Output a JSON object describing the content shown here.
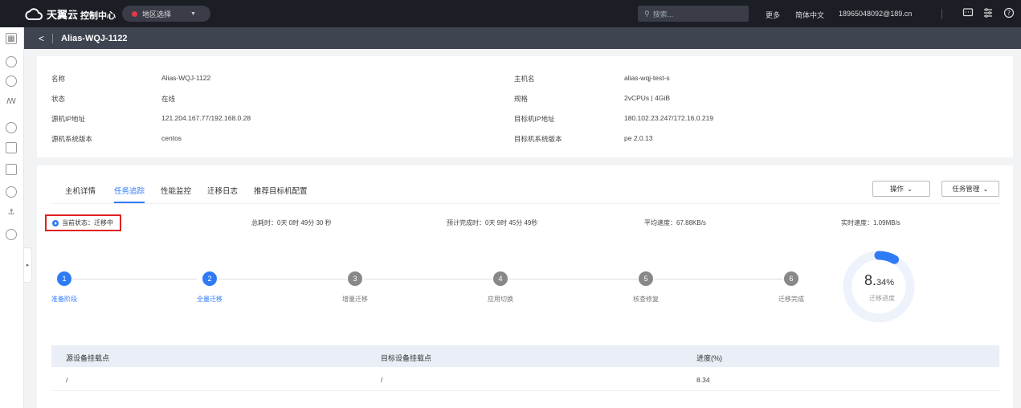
{
  "topbar": {
    "brand": "天翼云",
    "console": "控制中心",
    "region": "地区选择",
    "search_placeholder": "搜索...",
    "more": "更多",
    "language": "简体中文",
    "user": "18965048092@189.cn"
  },
  "subheader": {
    "back": "<",
    "title": "Alias-WQJ-1122"
  },
  "info": {
    "left": [
      {
        "label": "名称",
        "value": "Alias-WQJ-1122"
      },
      {
        "label": "状态",
        "value": "在线"
      },
      {
        "label": "源机IP地址",
        "value": "121.204.167.77/192.168.0.28"
      },
      {
        "label": "源机系统版本",
        "value": "centos"
      }
    ],
    "right": [
      {
        "label": "主机名",
        "value": "alias-wqj-test-s"
      },
      {
        "label": "规格",
        "value": "2vCPUs | 4GiB"
      },
      {
        "label": "目标机IP地址",
        "value": "180.102.23.247/172.16.0.219"
      },
      {
        "label": "目标机系统版本",
        "value": "pe 2.0.13"
      }
    ]
  },
  "tabs": [
    "主机详情",
    "任务追踪",
    "性能监控",
    "迁移日志",
    "推荐目标机配置"
  ],
  "active_tab": "任务追踪",
  "buttons": {
    "operate": "操作",
    "task_manage": "任务管理"
  },
  "status": {
    "current": "当前状态：迁移中",
    "elapsed": "总耗时：0天 0时 49分 30 秒",
    "eta": "预计完成时：0天 9时 45分 49秒",
    "avg_speed": "平均速度：67.88KB/s",
    "realtime_speed": "实时速度：1.09MB/s"
  },
  "steps": [
    {
      "num": "1",
      "label": "准备阶段",
      "done": true
    },
    {
      "num": "2",
      "label": "全量迁移",
      "done": true
    },
    {
      "num": "3",
      "label": "增量迁移",
      "done": false
    },
    {
      "num": "4",
      "label": "应用切换",
      "done": false
    },
    {
      "num": "5",
      "label": "核查修复",
      "done": false
    },
    {
      "num": "6",
      "label": "迁移完成",
      "done": false
    }
  ],
  "progress": {
    "value_main": "8.",
    "value_dec": "34%",
    "fraction": 0.0834,
    "label": "迁移进度"
  },
  "table": {
    "headers": [
      "源设备挂载点",
      "目标设备挂载点",
      "进度(%)"
    ],
    "rows": [
      [
        "/",
        "/",
        "8.34"
      ]
    ]
  },
  "colors": {
    "accent": "#2f7bf5",
    "topbar": "#1c1e26",
    "highlight": "#e02020"
  }
}
